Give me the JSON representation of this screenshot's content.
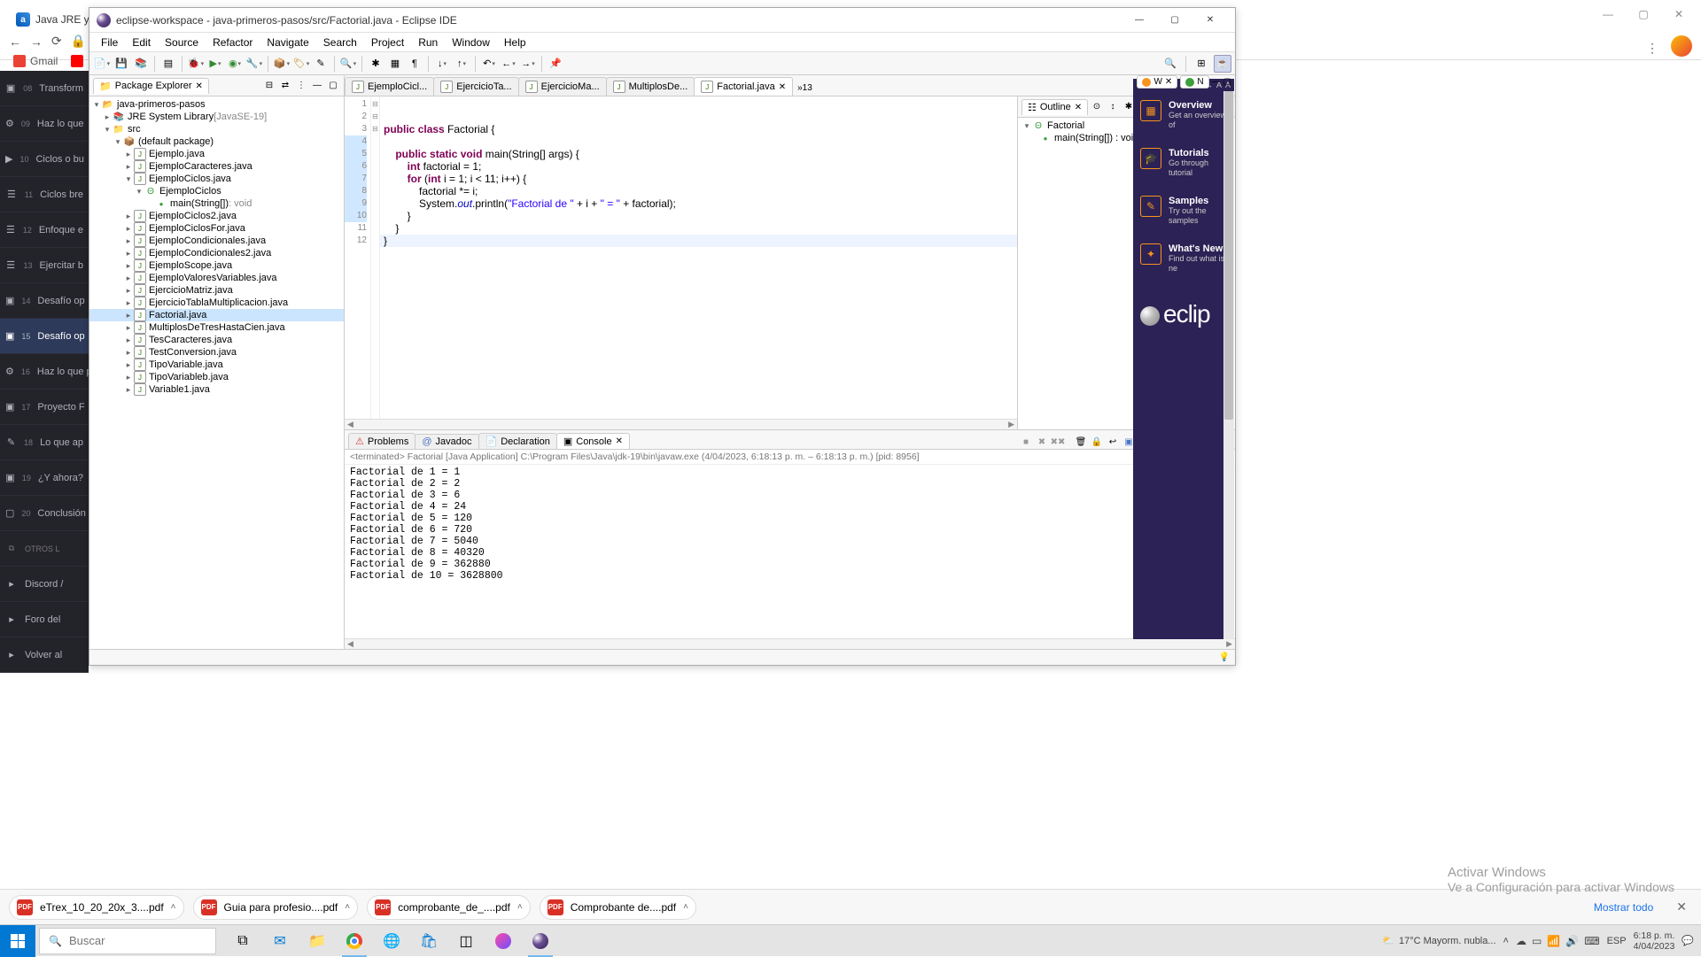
{
  "browser": {
    "tab_title": "Java JRE y JDK: c",
    "bookmarks": {
      "gmail": "Gmail",
      "youtube": "You"
    },
    "nav": {
      "back": "←",
      "fwd": "→",
      "reload": "⟳"
    }
  },
  "course_sidebar": {
    "items": [
      {
        "num": "08",
        "label": "Transform",
        "icon": "▣"
      },
      {
        "num": "09",
        "label": "Haz lo que",
        "icon": "⚙"
      },
      {
        "num": "10",
        "label": "Ciclos o bu",
        "icon": "▶"
      },
      {
        "num": "11",
        "label": "Ciclos bre",
        "icon": "☰"
      },
      {
        "num": "12",
        "label": "Enfoque e",
        "icon": "☰"
      },
      {
        "num": "13",
        "label": "Ejercitar b",
        "icon": "☰"
      },
      {
        "num": "14",
        "label": "Desafío op",
        "icon": "▣"
      },
      {
        "num": "15",
        "label": "Desafío op",
        "icon": "▣",
        "active": true
      },
      {
        "num": "16",
        "label": "Haz lo que profundos",
        "icon": "⚙"
      },
      {
        "num": "17",
        "label": "Proyecto F",
        "icon": "▣"
      },
      {
        "num": "18",
        "label": "Lo que ap",
        "icon": "✎"
      },
      {
        "num": "19",
        "label": "¿Y ahora?",
        "icon": "▣"
      },
      {
        "num": "20",
        "label": "Conclusión",
        "icon": "▢"
      }
    ],
    "otros": "OTROS L",
    "quick": [
      {
        "label": "Discord /"
      },
      {
        "label": "Foro del"
      },
      {
        "label": "Volver al"
      }
    ]
  },
  "eclipse": {
    "title": "eclipse-workspace - java-primeros-pasos/src/Factorial.java - Eclipse IDE",
    "menu": [
      "File",
      "Edit",
      "Source",
      "Refactor",
      "Navigate",
      "Search",
      "Project",
      "Run",
      "Window",
      "Help"
    ],
    "pkg_explorer": {
      "title": "Package Explorer",
      "project": "java-primeros-pasos",
      "jre": "JRE System Library",
      "jre_ver": "[JavaSE-19]",
      "src": "src",
      "default_pkg": "(default package)",
      "files": [
        "Ejemplo.java",
        "EjemploCaracteres.java",
        "EjemploCiclos.java",
        "EjemploCiclos2.java",
        "EjemploCiclosFor.java",
        "EjemploCondicionales.java",
        "EjemploCondicionales2.java",
        "EjemploScope.java",
        "EjemploValoresVariables.java",
        "EjercicioMatriz.java",
        "EjercicioTablaMultiplicacion.java",
        "Factorial.java",
        "MultiplosDeTresHastaCien.java",
        "TesCaracteres.java",
        "TestConversion.java",
        "TipoVariable.java",
        "TipoVariableb.java",
        "Variable1.java"
      ],
      "ejemplo_ciclos_class": "EjemploCiclos",
      "ejemplo_ciclos_main": "main(String[])",
      "ejemplo_ciclos_ret": ": void"
    },
    "editor_tabs": [
      {
        "label": "EjemploCicl..."
      },
      {
        "label": "EjercicioTa..."
      },
      {
        "label": "EjercicioMa..."
      },
      {
        "label": "MultiplosDe..."
      },
      {
        "label": "Factorial.java",
        "active": true,
        "closable": true
      }
    ],
    "editor_overflow": "»13",
    "code_lines": [
      "1",
      "2",
      "3",
      "4",
      "5",
      "6",
      "7",
      "8",
      "9",
      "10",
      "11",
      "12"
    ],
    "outline": {
      "title": "Outline",
      "root": "Factorial",
      "main": "main(String[]) : void"
    },
    "persp": {
      "w_label": "W",
      "n_label": "N"
    },
    "bottom_tabs": {
      "problems": "Problems",
      "javadoc": "Javadoc",
      "declaration": "Declaration",
      "console": "Console"
    },
    "console_status": "<terminated> Factorial [Java Application] C:\\Program Files\\Java\\jdk-19\\bin\\javaw.exe  (4/04/2023, 6:18:13 p. m. – 6:18:13 p. m.) [pid: 8956]",
    "console_output": "Factorial de 1 = 1\nFactorial de 2 = 2\nFactorial de 3 = 6\nFactorial de 4 = 24\nFactorial de 5 = 120\nFactorial de 6 = 720\nFactorial de 7 = 5040\nFactorial de 8 = 40320\nFactorial de 9 = 362880\nFactorial de 10 = 3628800"
  },
  "welcome": {
    "items": [
      {
        "title": "Overview",
        "sub": "Get an overview of",
        "icon": "▦"
      },
      {
        "title": "Tutorials",
        "sub": "Go through tutorial",
        "icon": "🎓"
      },
      {
        "title": "Samples",
        "sub": "Try out the samples",
        "icon": "✎"
      },
      {
        "title": "What's New",
        "sub": "Find out what is ne",
        "icon": "✦"
      }
    ],
    "logo": "eclip"
  },
  "watermark": {
    "title": "Activar Windows",
    "sub": "Ve a Configuración para activar Windows"
  },
  "downloads": {
    "items": [
      {
        "name": "eTrex_10_20_20x_3....pdf"
      },
      {
        "name": "Guia para profesio....pdf"
      },
      {
        "name": "comprobante_de_....pdf"
      },
      {
        "name": "Comprobante de....pdf"
      }
    ],
    "showall": "Mostrar todo"
  },
  "taskbar": {
    "search_placeholder": "Buscar",
    "weather": "17°C  Mayorm. nubla...",
    "lang": "ESP",
    "time": "6:18 p. m.",
    "date": "4/04/2023"
  }
}
